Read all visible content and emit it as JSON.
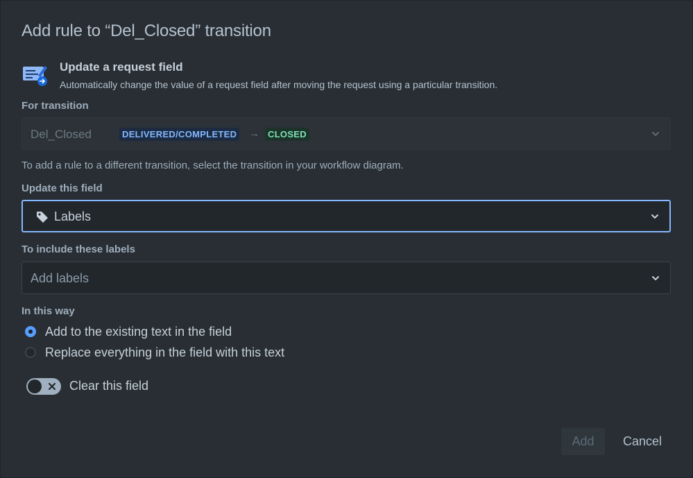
{
  "dialog": {
    "title": "Add rule to “Del_Closed” transition"
  },
  "rule": {
    "icon": "update-field-icon",
    "name": "Update a request field",
    "description": "Automatically change the value of a request field after moving the request using a particular transition."
  },
  "transition_field": {
    "label": "For transition",
    "name": "Del_Closed",
    "from_status": "DELIVERED/COMPLETED",
    "to_status": "CLOSED",
    "helper": "To add a rule to a different transition, select the transition in your workflow diagram."
  },
  "update_field": {
    "label": "Update this field",
    "value": "Labels",
    "icon": "tag-icon"
  },
  "labels_field": {
    "label": "To include these labels",
    "placeholder": "Add labels"
  },
  "mode": {
    "label": "In this way",
    "options": [
      {
        "label": "Add to the existing text in the field",
        "checked": true
      },
      {
        "label": "Replace everything in the field with this text",
        "checked": false
      }
    ]
  },
  "clear_toggle": {
    "label": "Clear this field",
    "on": false
  },
  "buttons": {
    "add": "Add",
    "cancel": "Cancel"
  },
  "colors": {
    "background": "#282e33",
    "accent": "#579dff",
    "focus_border": "#85b8ff",
    "status_blue": "#85b8ff",
    "status_green": "#7ee2b8"
  }
}
